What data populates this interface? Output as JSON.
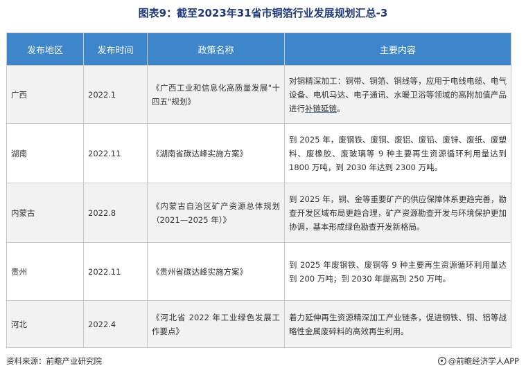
{
  "title": "图表9：截至2023年31省市铜箔行业发展规划汇总-3",
  "table": {
    "headers": [
      "发布地区",
      "发布时间",
      "政策名称",
      "主要内容"
    ],
    "rows": [
      {
        "region": "广西",
        "time": "2022.1",
        "name": "《广西工业和信息化高质量发展\"十四五\"规划》",
        "content_before": "对铜精深加工：铜带、铜箔、铜线等，应用于电线电缆、电气设备、电机马达、电子通讯、水暖卫浴等领域的高附加值产品进行",
        "content_underlined": "补链延链",
        "content_after": "。"
      },
      {
        "region": "湖南",
        "time": "2022.11",
        "name": "《湖南省碳达峰实施方案》",
        "content": "到 2025 年，废钢铁、废铜、废铝、废铅、废锌、废纸、废塑料、废橡胶、废玻璃等 9 种主要再生资源循环利用量达到 1800 万吨，到 2030 年达到 2300 万吨。"
      },
      {
        "region": "内蒙古",
        "time": "2022.8",
        "name": "《内蒙古自治区矿产资源总体规划（2021—2025 年）》",
        "content": "到 2025 年，铜、金等重要矿产的供应保障体系更趋完善，勘查开发区域布局更趋合理，矿产资源勘查开发与环境保护更加协调，基本形成绿色勘查开发新格局。"
      },
      {
        "region": "贵州",
        "time": "2022.11",
        "name": "《贵州省碳达峰实施方案》",
        "content": "到 2025 年废钢铁、废铜等 9 种主要再生资源循环利用量达到 200 万吨；到 2030 年提高到 250 万吨。"
      },
      {
        "region": "河北",
        "time": "2022.4",
        "name": "《河北省 2022 年工业绿色发展工作要点》",
        "content": "着力延伸再生资源精深加工产业链条，促进钢铁、铜、铝等战略性金属废碎料的高效再生利用。"
      }
    ]
  },
  "footer": {
    "source": "资料来源：前瞻产业研究院",
    "brand": "@前瞻经济学人APP",
    "brand_icon": "brand-logo-icon"
  }
}
